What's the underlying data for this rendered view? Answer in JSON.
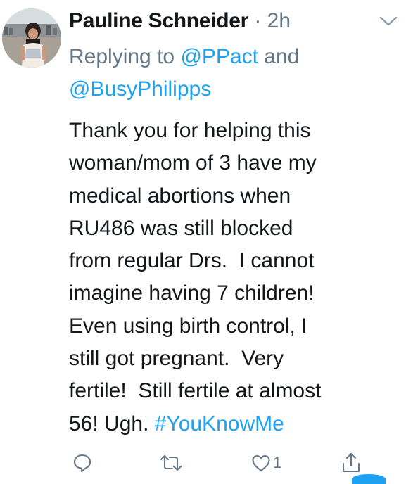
{
  "tweet": {
    "author_name": "Pauline Schneider",
    "separator": " · ",
    "timestamp": "2h",
    "replying_prefix": "Replying to ",
    "mention_1": "@PPact",
    "replying_and": " and",
    "mention_2": "@BusyPhilipps",
    "body_lines": [
      "Thank you for helping this",
      "woman/mom of 3 have my",
      "medical abortions when",
      "RU486 was still blocked",
      "from regular Drs.  I cannot",
      "imagine having 7 children!",
      "Even using birth control, I",
      "still got pregnant.  Very",
      "fertile!  Still fertile at almost"
    ],
    "last_line_text": "56! Ugh. ",
    "hashtag": "#YouKnowMe",
    "like_count": "1"
  },
  "icons": {
    "menu": "chevron-down-icon",
    "reply": "reply-icon",
    "retweet": "retweet-icon",
    "like": "heart-icon",
    "share": "share-icon"
  },
  "colors": {
    "text_primary": "#14171a",
    "text_secondary": "#657786",
    "accent": "#1da1f2"
  }
}
